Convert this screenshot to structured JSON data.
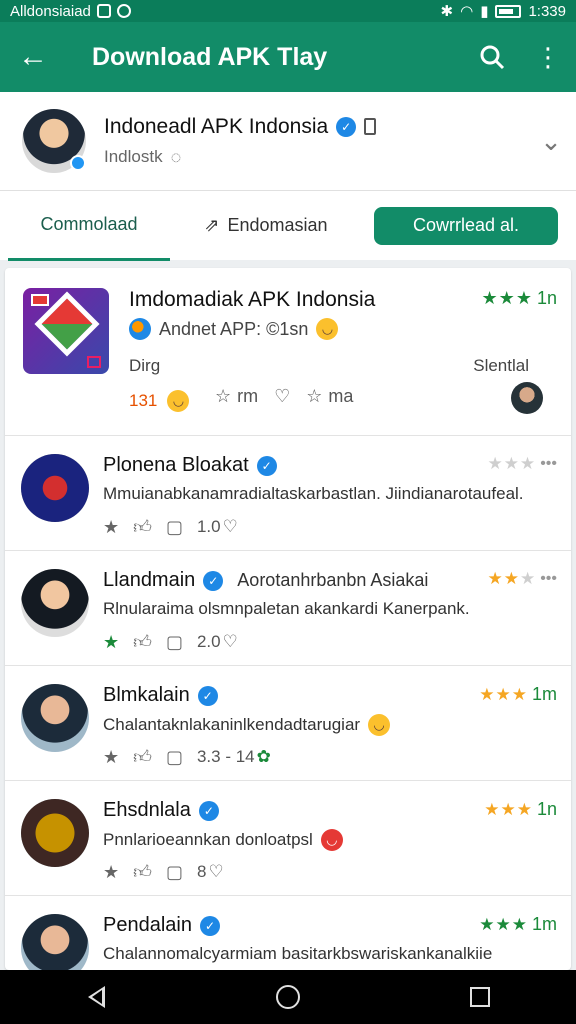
{
  "status_bar": {
    "carrier": "Alldonsiaiad",
    "time": "1:339"
  },
  "app_bar": {
    "title": "Download APK Tlay"
  },
  "account": {
    "name": "Indoneadl APK Indonsia",
    "subtitle": "Indlostk"
  },
  "tabs": {
    "tab1": "Commolaad",
    "tab2": "Endomasian",
    "download_all": "Cowrrlead al."
  },
  "featured": {
    "title": "Imdomadiak APK Indonsia",
    "subtitle": "Andnet APP: ©1sn",
    "label": "Dirg",
    "count": "131",
    "action1": "rm",
    "action2": "ma",
    "seller": "Slentlal",
    "rating_suffix": "1n"
  },
  "items": [
    {
      "title": "Plonena Bloakat",
      "title_extra": "",
      "desc": "Mmuianabkanamradialtaskarbastlan. Jiindianarotaufeal.",
      "count": "1.0",
      "rating_suffix": ""
    },
    {
      "title": "Llandmain",
      "title_extra": "Aorotanhrbanbn Asiakai",
      "desc": "Rlnularaima olsmnpaletan akankardi Kanerpank.",
      "count": "2.0",
      "rating_suffix": ""
    },
    {
      "title": "Blmkalain",
      "title_extra": "",
      "desc": "Chalantaknlakaninlkendadtarugiar",
      "count": "3.3 - 14",
      "rating_suffix": "1m"
    },
    {
      "title": "Ehsdnlala",
      "title_extra": "",
      "desc": "Pnnlarioeannkan donloatpsl",
      "count": "8",
      "rating_suffix": "1n"
    },
    {
      "title": "Pendalain",
      "title_extra": "",
      "desc": "Chalannomalcyarmiam basitarkbswariskankanalkiie",
      "count": "",
      "rating_suffix": "1m"
    }
  ],
  "colors": {
    "primary": "#128c68",
    "star_green": "#1b8a3a",
    "star_orange": "#f5a623"
  }
}
